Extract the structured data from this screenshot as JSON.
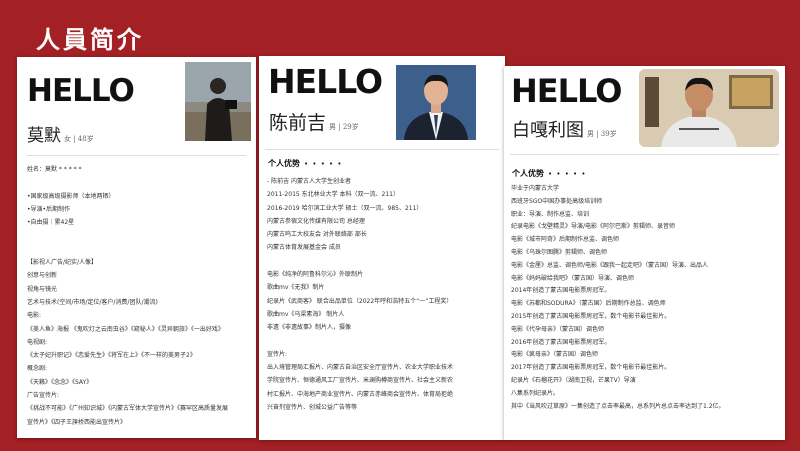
{
  "page": {
    "title": "人員简介"
  },
  "cards": [
    {
      "hello": "HELLO",
      "name": "莫默",
      "meta": "女 | 48岁",
      "lines": [
        "姓名：莫默 * * * * *",
        "",
        "•国家级高级摄影师（本地两栖）",
        "•导演•后期制作",
        "•自由摄｜累42星",
        "",
        "",
        "【影视人广告/纪实/人像】",
        "创意与创新",
        "视角与镜光",
        "艺术与技术(空间/市场/定位/客户/消费/团队/潮流)",
        "电影:",
        "《美人鱼》海报 《鬼吹灯之云南虫谷》《窥秘人》《灵异朝旅》《一出好戏》",
        "电视剧:",
        "《太子妃升职记》《恋爱先生》《将军在上》《不一样的美男子2》",
        "概念剧:",
        "《天籁》《念念》《SAY》",
        "广告宣传片:",
        "《挑战不可能》《广州知识城》《内蒙古军体大学宣传片》《赛罕区高质量发展",
        "宣传片》《四子王旗桥西能出宣传片》"
      ]
    },
    {
      "hello": "HELLO",
      "name": "陈前吉",
      "meta": "男 | 29岁",
      "section": "个人优势",
      "stars": "• • • • •",
      "lines": [
        "- 陈前吉 内蒙古人大学生创业者",
        "2011-2015 东北林业大学   本科（双一流、211）",
        "2016-2019 哈尔滨工业大学  硕士（双一流、985、211）",
        "  内蒙古参宿文化传媒有限公司 总经理",
        "  内蒙古呜工大校友会 对外联络部 部长",
        "  内蒙古体育发展基金会 成员",
        "",
        "电影《纯净的阿鲁科尔沁》外联制片",
        "歌曲mv《无我》制片",
        "纪录片《武商客》 联合出品单位（2022年呼和浩特五个“一”工程奖）",
        "歌曲mv《乌梁素海》 制片人",
        "非遗《非遗故事》制片人，摄像",
        "",
        "宣传片:",
        "出入境管理局汇报片、内蒙古自治区安全厅宣传片、农业大学职业技术",
        "学院宣传片、恒德通风工厂宣传片、米澜购樽商宣传片、社会主义新农",
        "村汇报片、中海地产商业宣传片、内蒙古赤峰商会宣传片、体育局拒绝",
        "兴奋剂宣传片、创城公益广告等等"
      ]
    },
    {
      "hello": "HELLO",
      "name": "白嘎利图",
      "meta": "男 | 39岁",
      "section": "个人优势",
      "stars": "• • • • •",
      "lines": [
        "毕业于内蒙古大学",
        "西班牙SGO中国办事处高级培训师",
        "职业：导演、制作总监、培训",
        "纪录电影《戈壁精灵》导演/电影《阿尔巴斯》剪辑师、录音师",
        "电影《城市阿奇》后期制作总监、调色师",
        "电影《乌珠尔图腾》剪辑师、调色师",
        "电影《金厘》总监、调色师/电影《跟我一起走吧》（蒙古国）导演、出品人",
        "电影《妈妈破给我吧》（蒙古国）导演、调色师",
        "    2014年创造了蒙古国电影票房冠军。",
        "电影《苏都和SODURA》（蒙古国）后期制作总监、调色师",
        "2015年创造了蒙古国电影票房冠军，数个电影节最佳影片。",
        "电影《代孕母亲》（蒙古国）调色师",
        "    2016年创造了蒙古国电影票房冠军。",
        "电影《疯母亲》（蒙古国）调色师",
        "    2017年创造了蒙古国电影票房冠军，数个电影节最佳影片。",
        "纪录片《石榴花开》（湖南卫视，芒果TV）导演",
        "八集系列纪录片。",
        "其中《当风吹过草原》一集创造了点击率最高，总系列片总点击率达到了1.2亿。"
      ]
    }
  ],
  "colors": {
    "background": "#a32024",
    "card": "#ffffff",
    "text": "#333333"
  }
}
